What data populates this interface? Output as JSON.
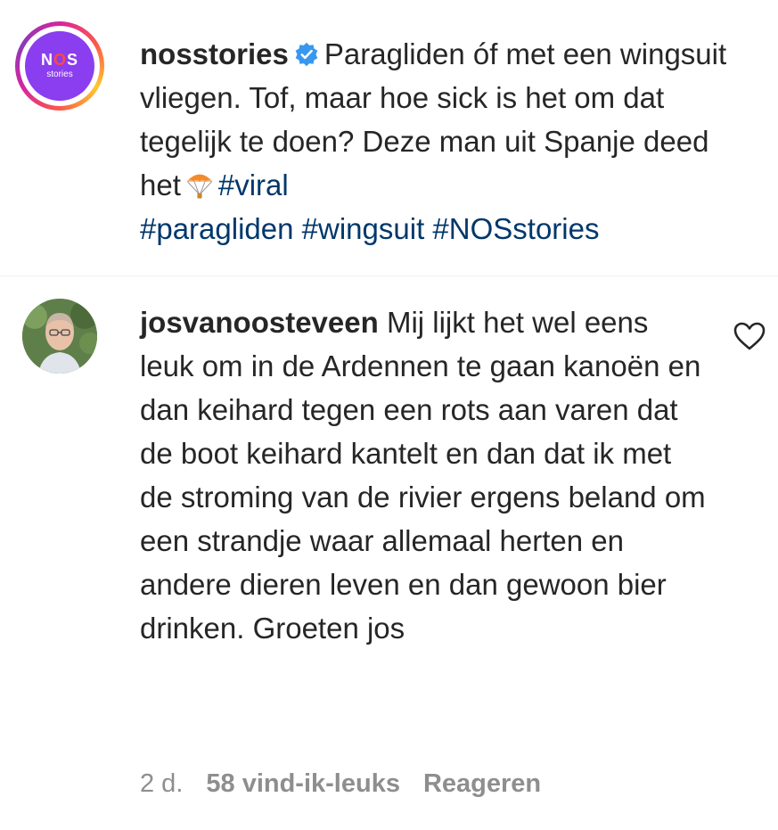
{
  "post": {
    "avatar_text_top": "NOS",
    "avatar_text_bottom": "stories",
    "username": "nosstories",
    "caption_text_1": "Paragliden óf met een wingsuit vliegen. Tof, maar hoe sick is het om dat tegelijk te doen? Deze man uit Spanje deed het",
    "hashtags": [
      "#viral",
      "#paragliden",
      "#wingsuit",
      "#NOSstories"
    ],
    "colors": {
      "brand": "#8b3df0",
      "hashtag": "#00376b",
      "verified": "#3897f0"
    },
    "icons": {
      "verified": "verified-badge-icon",
      "emoji": "parachute-emoji-icon"
    }
  },
  "comment": {
    "username": "josvanoosteveen",
    "text": "Mij lijkt het wel eens leuk om in de Ardennen te gaan kanoën en dan keihard tegen een rots aan varen dat de boot keihard kantelt en dan dat ik met de stroming van de rivier ergens beland om een strandje waar allemaal herten en andere dieren leven en dan gewoon bier drinken. Groeten jos",
    "time": "2 d.",
    "likes": "58 vind-ik-leuks",
    "reply": "Reageren",
    "icons": {
      "like": "heart-outline-icon"
    }
  }
}
